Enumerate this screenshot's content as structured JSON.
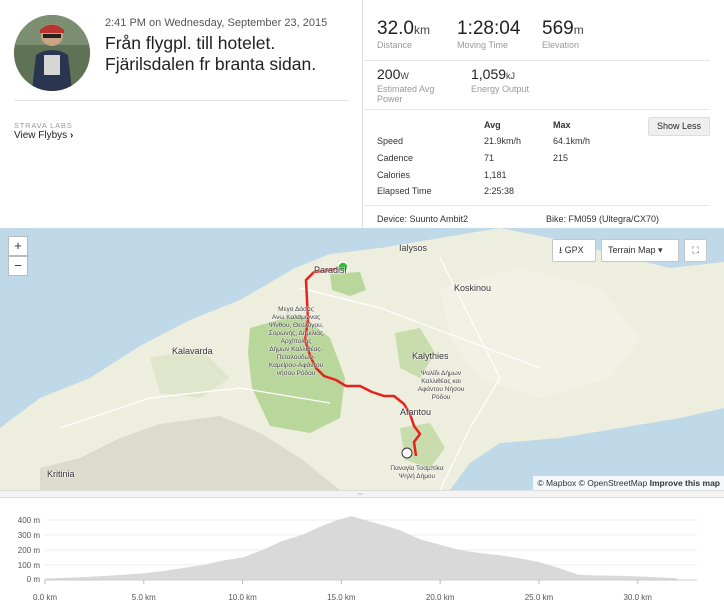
{
  "activity": {
    "time": "2:41 PM",
    "date_text": " on Wednesday, September 23, 2015",
    "title_line1": "Från flygpl. till hotelet.",
    "title_line2": "Fjärilsdalen fr branta sidan."
  },
  "labs": {
    "label": "STRAVA LABS",
    "flybys_label": "View Flybys",
    "flybys_icon": "chevron-right-icon"
  },
  "stats": {
    "distance": {
      "value": "32.0",
      "unit": "km",
      "label": "Distance"
    },
    "moving_time": {
      "value": "1:28:04",
      "label": "Moving Time"
    },
    "elevation": {
      "value": "569",
      "unit": "m",
      "label": "Elevation"
    },
    "power": {
      "value": "200",
      "unit": "W",
      "label_line1": "Estimated Avg",
      "label_line2": "Power"
    },
    "energy": {
      "value": "1,059",
      "unit": "kJ",
      "label": "Energy Output"
    }
  },
  "table": {
    "col_avg": "Avg",
    "col_max": "Max",
    "show_less_label": "Show Less",
    "rows": [
      {
        "label": "Speed",
        "avg": "21.9km/h",
        "max": "64.1km/h"
      },
      {
        "label": "Cadence",
        "avg": "71",
        "max": "215"
      },
      {
        "label": "Calories",
        "avg": "1,181",
        "max": ""
      },
      {
        "label": "Elapsed Time",
        "avg": "2:25:38",
        "max": ""
      }
    ],
    "device": "Device: Suunto Ambit2",
    "bike": "Bike: FM059 (Ultegra/CX70)"
  },
  "map": {
    "zoom_in": "+",
    "zoom_out": "−",
    "gpx_label": "GPX",
    "terrain_label": "Terrain Map",
    "places": {
      "ialysos": "Ialysos",
      "paradisi": "Paradisi",
      "koskinou": "Koskinou",
      "kalavarda": "Kalavarda",
      "kalythies": "Kalythies",
      "afantou": "Afantou",
      "kritinia": "Kritinia"
    },
    "small_labels": {
      "mega_line1": "Μεγα Δάσος",
      "mega_line2": "Ανω Καλαμώνας",
      "mega_line3": "Ψίνθου, Θεολόγου,",
      "mega_line4": "Σορωνής, Δημιλιάς",
      "mega_line5": "Αρχίπολης",
      "mega_line6": "Δήμων Καλλιθέας-",
      "mega_line7": "Πεταλουδων-",
      "mega_line8": "Καμείρου-Αφάντου",
      "mega_line9": "νήσου Ρόδου",
      "psal_line1": "Ψαλίδι Δήμων",
      "psal_line2": "Καλλιθέας και",
      "psal_line3": "Αφάντου Νήσου",
      "psal_line4": "Ρόδου",
      "pan_line1": "Παναγία Τσαμπίκα",
      "pan_line2": "Ψηλή Δήμου"
    },
    "attribution": {
      "mapbox": "© Mapbox",
      "osm": "© OpenStreetMap",
      "improve": "Improve this map"
    },
    "colors": {
      "route": "#e8211c",
      "start": "#2ebd2e",
      "water": "#bfd9e8",
      "land": "#eeeedf",
      "forest": "#b9d69b"
    }
  },
  "chart_data": {
    "type": "area",
    "title": "",
    "xlabel": "",
    "ylabel": "",
    "x_unit": "km",
    "y_unit": "m",
    "xlim": [
      0,
      33
    ],
    "ylim": [
      0,
      450
    ],
    "x_ticks": [
      "0.0 km",
      "5.0 km",
      "10.0 km",
      "15.0 km",
      "20.0 km",
      "25.0 km",
      "30.0 km"
    ],
    "y_ticks": [
      "400 m",
      "300 m",
      "200 m",
      "100 m",
      "0 m"
    ],
    "x": [
      0,
      1,
      2,
      3,
      4,
      5,
      6,
      7,
      8,
      9,
      10,
      11,
      12,
      13,
      14,
      14.8,
      15.5,
      16.2,
      17,
      18,
      19,
      20,
      21,
      22,
      23,
      24,
      25,
      26,
      27,
      28,
      29,
      30,
      31,
      32
    ],
    "values": [
      10,
      14,
      20,
      27,
      35,
      45,
      60,
      80,
      100,
      130,
      150,
      200,
      260,
      300,
      360,
      400,
      425,
      400,
      370,
      330,
      270,
      235,
      200,
      180,
      165,
      145,
      120,
      80,
      35,
      30,
      28,
      24,
      18,
      12
    ],
    "color": "#d9d9d9"
  }
}
